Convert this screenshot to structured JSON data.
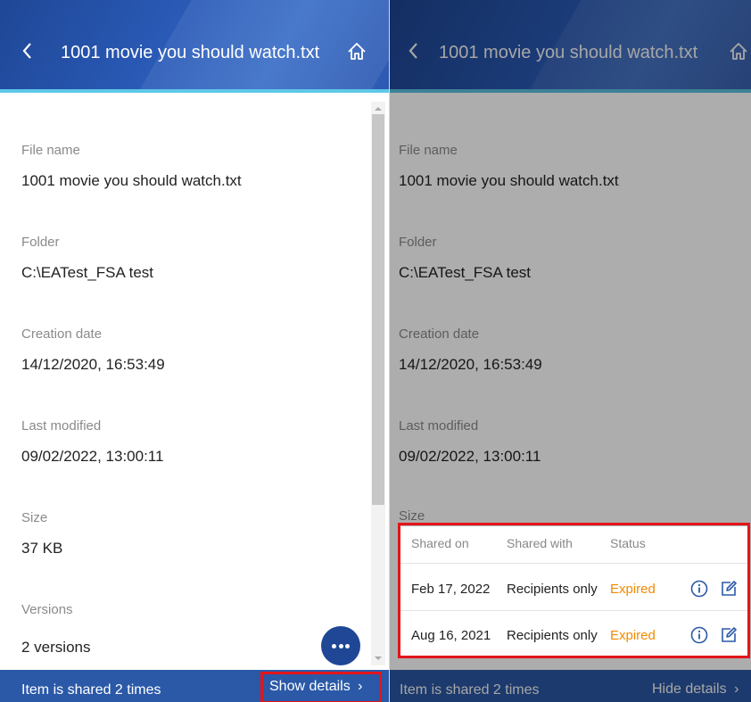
{
  "left": {
    "title": "1001 movie you should watch.txt",
    "fields": [
      {
        "label": "File name",
        "value": "1001 movie you should watch.txt"
      },
      {
        "label": "Folder",
        "value": "C:\\EATest_FSA test"
      },
      {
        "label": "Creation date",
        "value": "14/12/2020, 16:53:49"
      },
      {
        "label": "Last modified",
        "value": "09/02/2022, 13:00:11"
      },
      {
        "label": "Size",
        "value": "37 KB"
      },
      {
        "label": "Versions",
        "value": "2 versions"
      }
    ],
    "footer": {
      "text": "Item is shared 2 times",
      "details_label": "Show details",
      "chevron": "›"
    }
  },
  "right": {
    "title": "1001 movie you should watch.txt",
    "fields": [
      {
        "label": "File name",
        "value": "1001 movie you should watch.txt"
      },
      {
        "label": "Folder",
        "value": "C:\\EATest_FSA test"
      },
      {
        "label": "Creation date",
        "value": "14/12/2020, 16:53:49"
      },
      {
        "label": "Last modified",
        "value": "09/02/2022, 13:00:11"
      },
      {
        "label": "Size",
        "value": ""
      }
    ],
    "share_table": {
      "headers": {
        "shared_on": "Shared on",
        "shared_with": "Shared with",
        "status": "Status"
      },
      "rows": [
        {
          "shared_on": "Feb 17, 2022",
          "shared_with": "Recipients only",
          "status": "Expired"
        },
        {
          "shared_on": "Aug 16, 2021",
          "shared_with": "Recipients only",
          "status": "Expired"
        }
      ]
    },
    "footer": {
      "text": "Item is shared 2 times",
      "details_label": "Hide details",
      "chevron": "›"
    }
  },
  "icons": {
    "back": "chevron-left-icon",
    "home": "home-icon",
    "more": "more-horizontal-icon",
    "info": "info-icon",
    "edit": "edit-icon"
  },
  "colors": {
    "header": "#2a5bb8",
    "accent_line": "#5ec8e8",
    "footer": "#2b59a8",
    "status_expired": "#f28a00",
    "highlight": "#e3151a"
  }
}
